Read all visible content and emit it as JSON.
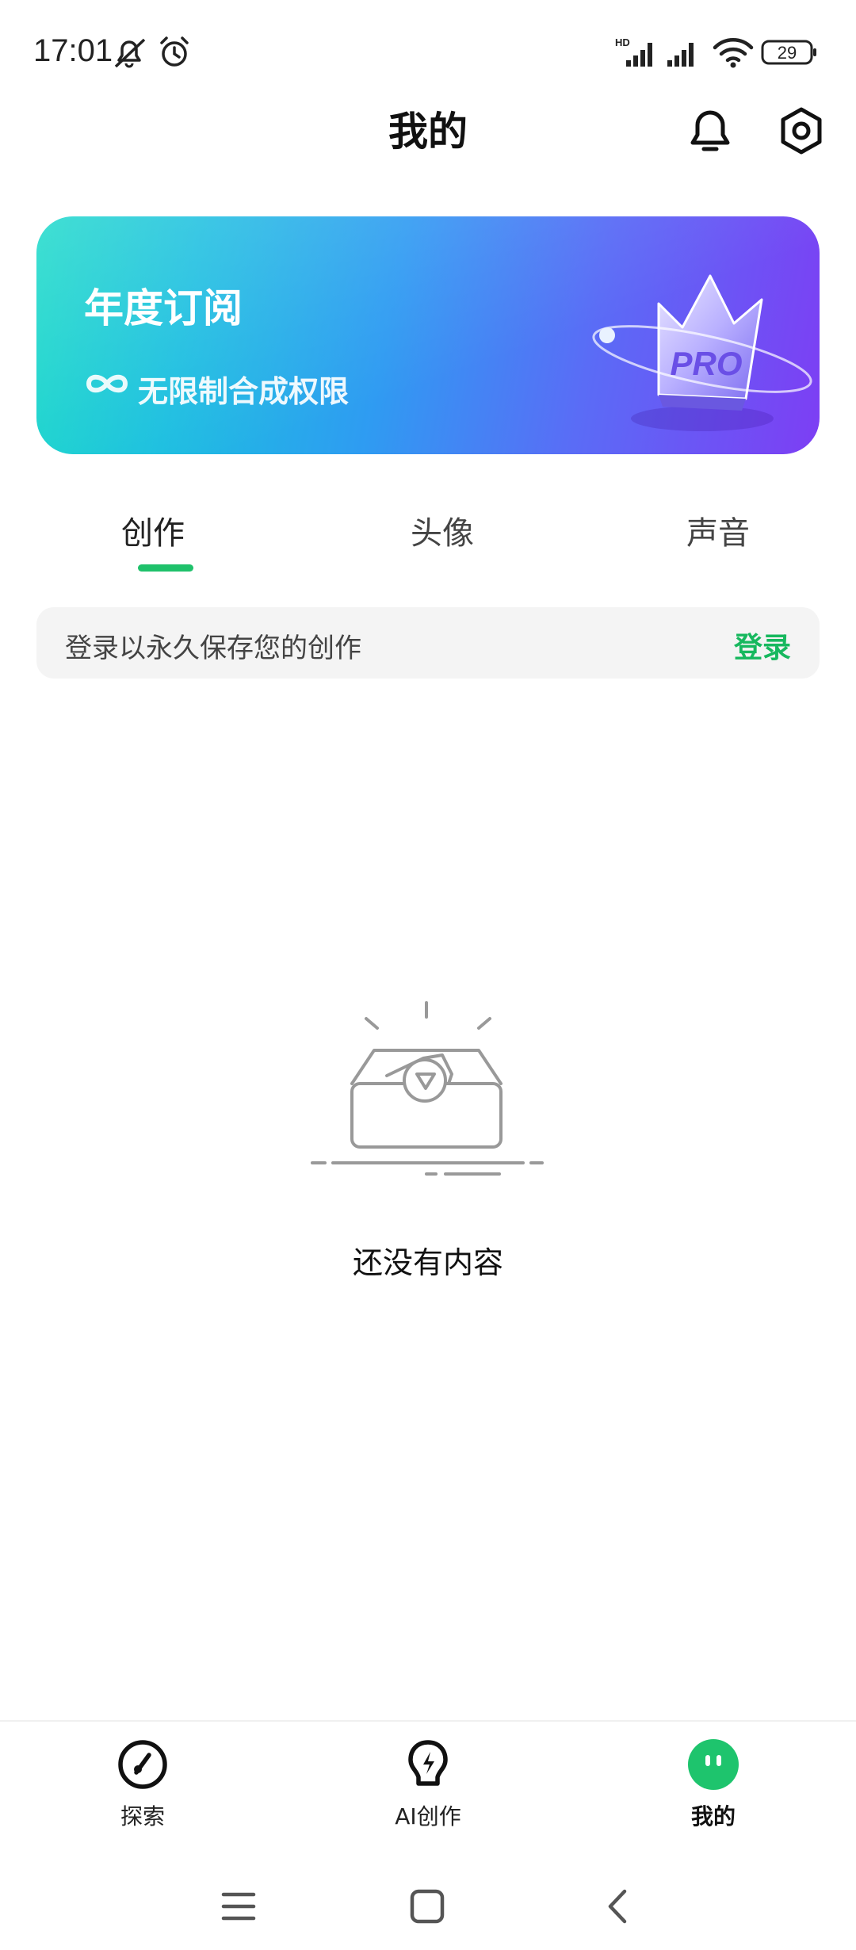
{
  "status_bar": {
    "time": "17:01",
    "battery": "29",
    "network_label": "HD"
  },
  "header": {
    "title": "我的",
    "icons": [
      "bell-icon",
      "settings-icon"
    ]
  },
  "banner": {
    "title": "年度订阅",
    "subtitle": "无限制合成权限",
    "badge": "PRO"
  },
  "tabs": [
    {
      "label": "创作",
      "active": true
    },
    {
      "label": "头像",
      "active": false
    },
    {
      "label": "声音",
      "active": false
    }
  ],
  "login_prompt": {
    "text": "登录以永久保存您的创作",
    "action": "登录"
  },
  "empty_state": {
    "text": "还没有内容"
  },
  "bottom_nav": [
    {
      "label": "探索",
      "icon": "compass-icon",
      "active": false
    },
    {
      "label": "AI创作",
      "icon": "bulb-icon",
      "active": false
    },
    {
      "label": "我的",
      "icon": "face-icon",
      "active": true
    }
  ],
  "colors": {
    "accent": "#1fc16b",
    "login_link": "#17b85e"
  }
}
